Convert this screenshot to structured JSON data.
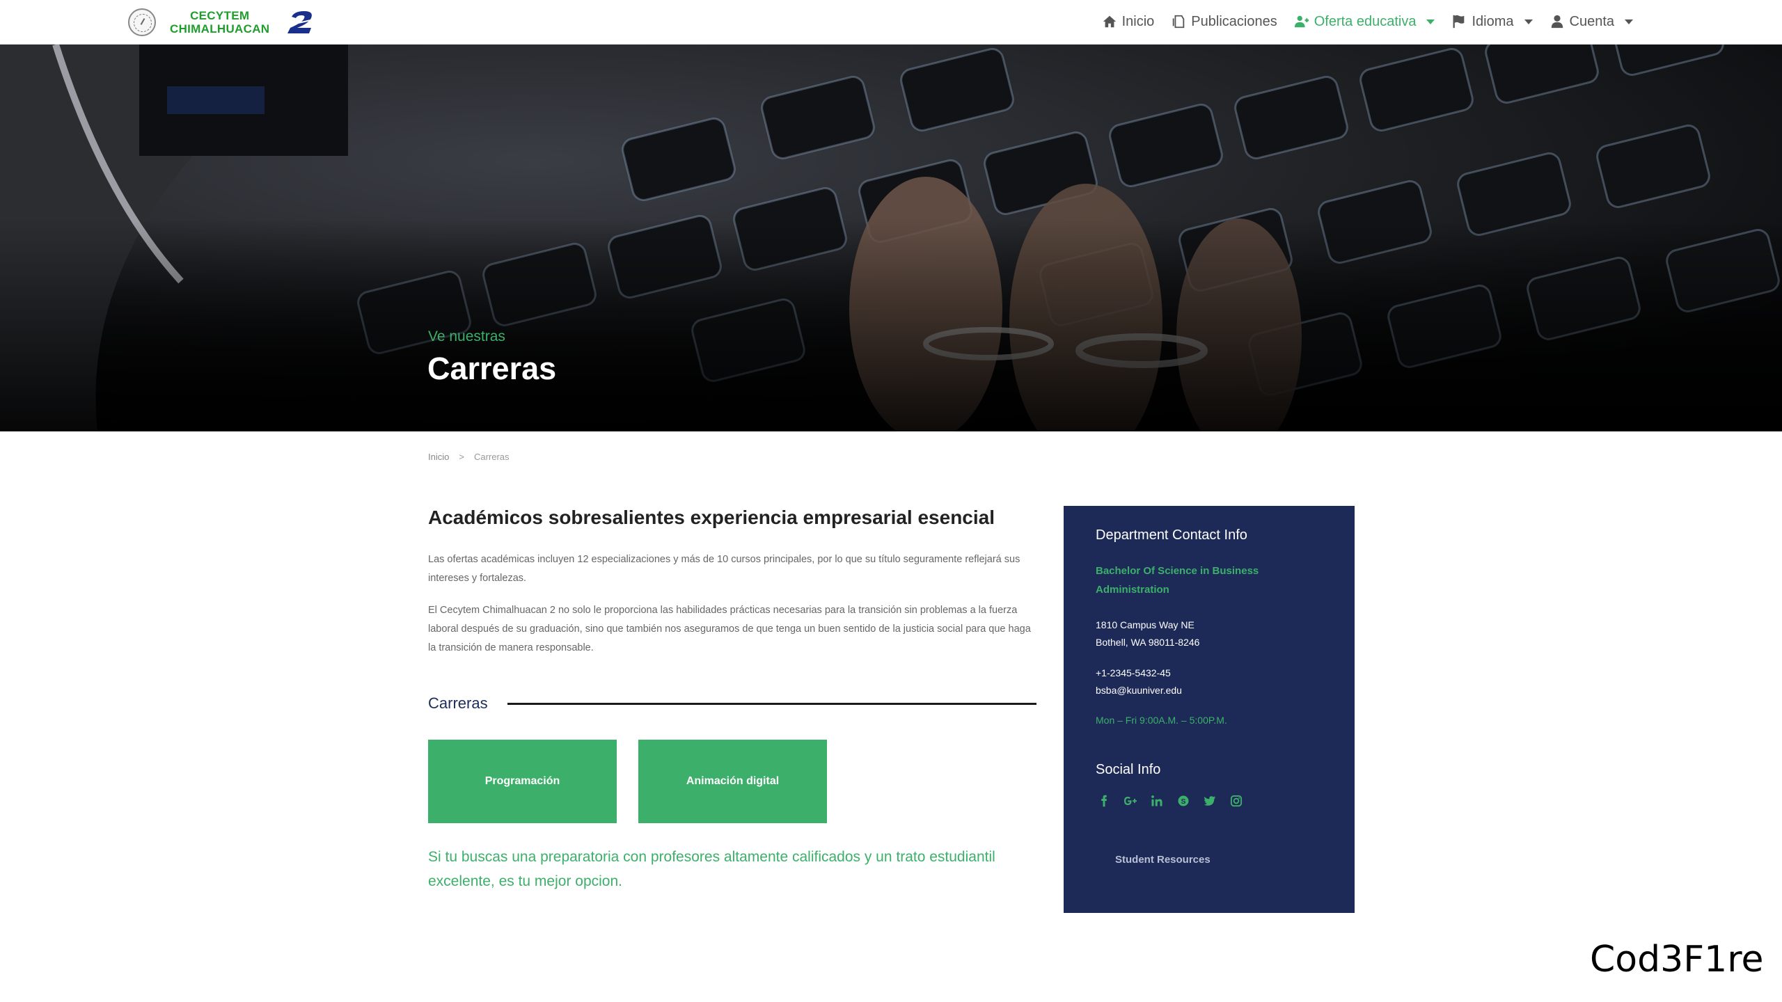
{
  "navbar": {
    "brand_line1": "CECYTEM",
    "brand_line2": "CHIMALHUACAN",
    "items": [
      {
        "label": "Inicio",
        "icon": "home-icon"
      },
      {
        "label": "Publicaciones",
        "icon": "publications-icon"
      },
      {
        "label": "Oferta educativa",
        "icon": "user-plus-icon",
        "active": true,
        "dropdown": true
      },
      {
        "label": "Idioma",
        "icon": "flag-icon",
        "dropdown": true
      },
      {
        "label": "Cuenta",
        "icon": "user-icon",
        "dropdown": true
      }
    ]
  },
  "hero": {
    "subtitle": "Ve nuestras",
    "title": "Carreras"
  },
  "breadcrumb": {
    "home": "Inicio",
    "separator": ">",
    "current": "Carreras"
  },
  "main": {
    "heading": "Académicos sobresalientes experiencia empresarial esencial",
    "paragraph1": "Las ofertas académicas incluyen 12 especializaciones y más de 10 cursos principales, por lo que su título seguramente reflejará sus intereses y fortalezas.",
    "paragraph2": "El Cecytem Chimalhuacan 2 no solo le proporciona las habilidades prácticas necesarias para la transición sin problemas a la fuerza laboral después de su graduación, sino que también nos aseguramos de que tenga un buen sentido de la justicia social para que haga la transición de manera responsable.",
    "section_label": "Carreras",
    "careers": [
      "Programación",
      "Animación digital"
    ],
    "tagline": "Si tu buscas una preparatoria con profesores altamente calificados y un trato estudiantil excelente, es tu mejor opcion."
  },
  "sidebar": {
    "title": "Department Contact Info",
    "program": "Bachelor Of Science in Business Administration",
    "address_line1": "1810 Campus Way NE",
    "address_line2": "Bothell, WA 98011-8246",
    "phone": "+1-2345-5432-45",
    "email": "bsba@kuuniver.edu",
    "hours": "Mon – Fri 9:00A.M. – 5:00P.M.",
    "social_title": "Social Info",
    "social_icons": [
      "facebook-icon",
      "google-plus-icon",
      "linkedin-icon",
      "skype-icon",
      "twitter-icon",
      "instagram-icon"
    ],
    "resources_label": "Student Resources"
  },
  "watermark": "Cod3F1re",
  "colors": {
    "accent": "#3cb06a",
    "sidebar_bg": "#1d2a58",
    "brand_green": "#1f9e2d",
    "brand_blue": "#1a2f8c"
  }
}
